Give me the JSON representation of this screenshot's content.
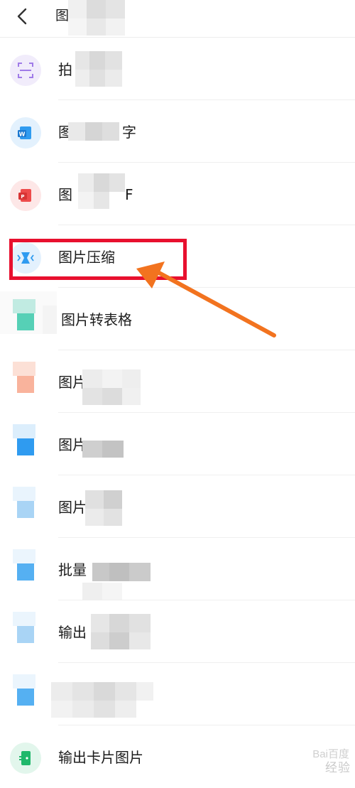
{
  "header": {
    "title": "图"
  },
  "items": [
    {
      "label": "拍"
    },
    {
      "label": "图"
    },
    {
      "label": "图"
    },
    {
      "label": "图片压缩"
    },
    {
      "label": "图片转表格"
    },
    {
      "label": "图片"
    },
    {
      "label": "图片"
    },
    {
      "label": "图片"
    },
    {
      "label": "批量"
    },
    {
      "label": "输出"
    },
    {
      "label": ""
    },
    {
      "label": "输出卡片图片"
    }
  ],
  "extra_label_fragments": {
    "item2_suffix": "字",
    "item3_suffix": "F"
  },
  "watermark": {
    "brand": "Bai",
    "brand2": "百度",
    "sub": "经验"
  },
  "colors": {
    "highlight_border": "#e8102e",
    "arrow": "#f2731f",
    "accent_blue": "#2f9bf0",
    "accent_teal": "#25c7a4",
    "accent_red": "#ee4b4b",
    "accent_purple": "#a07be8",
    "accent_green": "#1fb86b"
  }
}
